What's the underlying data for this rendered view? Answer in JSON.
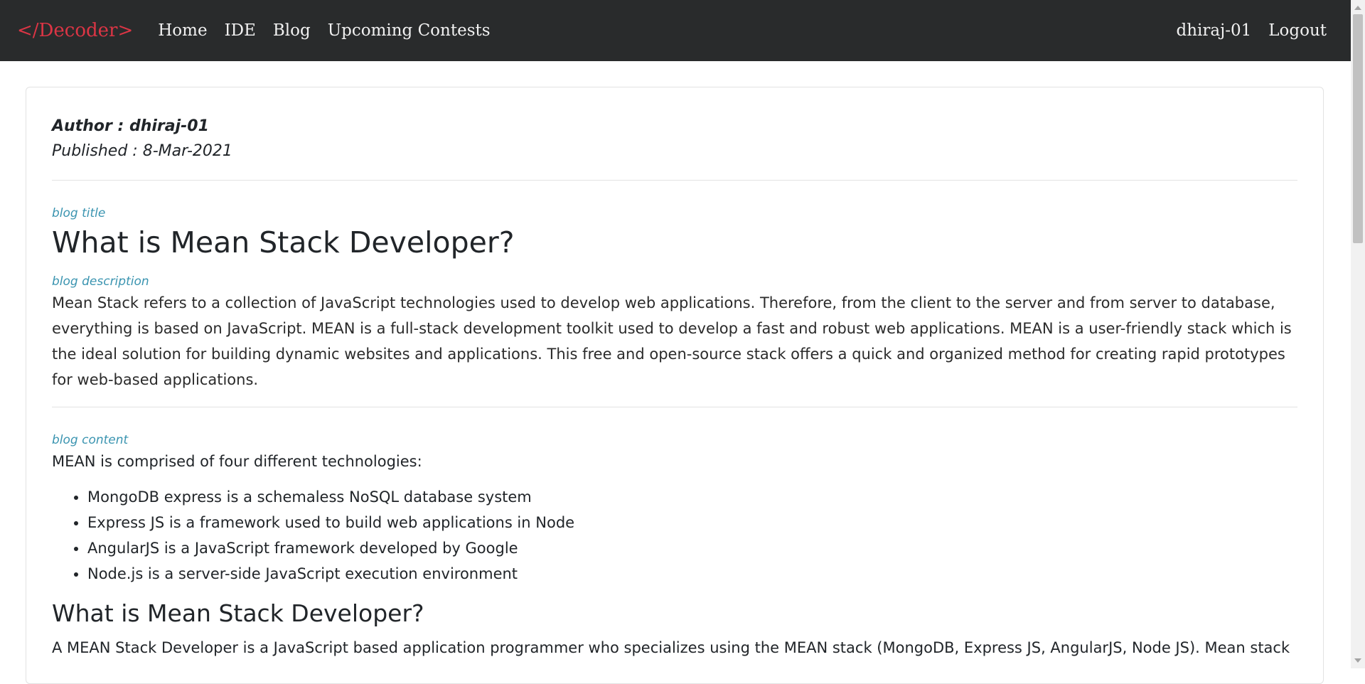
{
  "navbar": {
    "brand": "</Decoder>",
    "links": [
      "Home",
      "IDE",
      "Blog",
      "Upcoming Contests"
    ],
    "username": "dhiraj-01",
    "logout": "Logout"
  },
  "post": {
    "author": "Author : dhiraj-01",
    "published": "Published : 8-Mar-2021",
    "title_label": "blog title",
    "title": "What is Mean Stack Developer?",
    "description_label": "blog description",
    "description": "Mean Stack refers to a collection of JavaScript technologies used to develop web applications. Therefore, from the client to the server and from server to database, everything is based on JavaScript. MEAN is a full-stack development toolkit used to develop a fast and robust web applications. MEAN is a user-friendly stack which is the ideal solution for building dynamic websites and applications. This free and open-source stack offers a quick and organized method for creating rapid prototypes for web-based applications.",
    "content_label": "blog content",
    "content_intro": "MEAN is comprised of four different technologies:",
    "content_list": [
      "MongoDB express is a schemaless NoSQL database system",
      "Express JS is a framework used to build web applications in Node",
      "AngularJS is a JavaScript framework developed by Google",
      "Node.js is a server-side JavaScript execution environment"
    ],
    "content_heading": "What is Mean Stack Developer?",
    "content_paragraph": "A MEAN Stack Developer is a JavaScript based application programmer who specializes using the MEAN stack (MongoDB, Express JS, AngularJS, Node JS). Mean stack"
  },
  "colors": {
    "navbar_bg": "#292b2c",
    "brand": "#dc3545",
    "label": "#3a94b0"
  }
}
